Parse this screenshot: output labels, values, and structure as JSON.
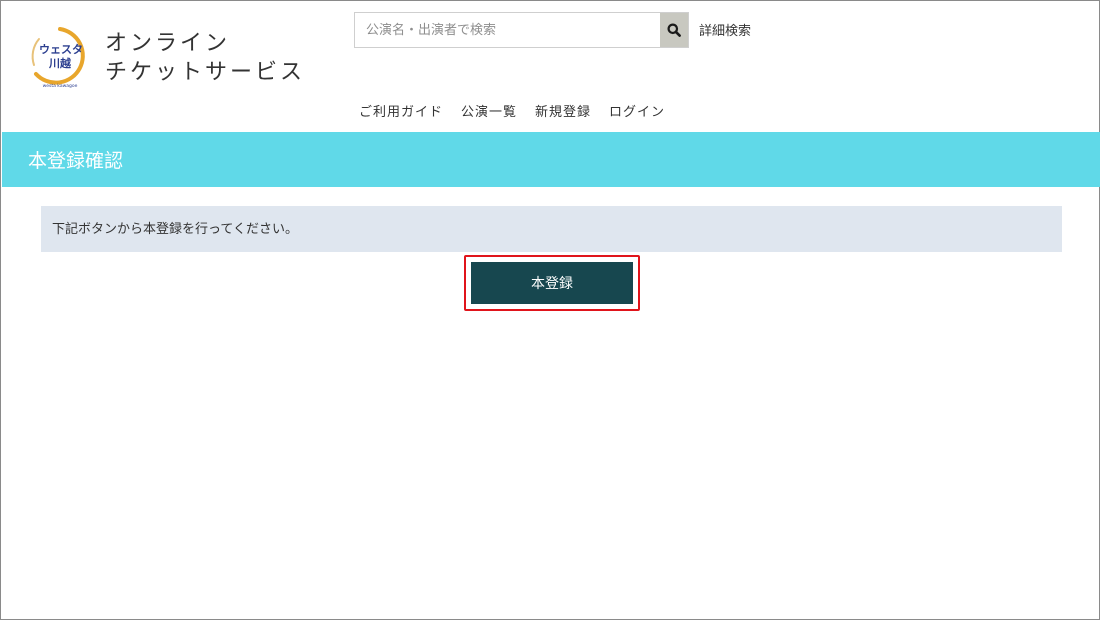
{
  "header": {
    "logo": {
      "lines": [
        "ウェスタ",
        "川越"
      ],
      "subtext": "westa kawagoe"
    },
    "site_title_line1": "オンライン",
    "site_title_line2": "チケットサービス",
    "search": {
      "placeholder": "公演名・出演者で検索",
      "value": "",
      "button_icon": "search-icon"
    },
    "advanced_search_label": "詳細検索",
    "nav": [
      "ご利用ガイド",
      "公演一覧",
      "新規登録",
      "ログイン"
    ]
  },
  "page": {
    "title": "本登録確認",
    "message": "下記ボタンから本登録を行ってください。",
    "register_button_label": "本登録"
  },
  "colors": {
    "title_band": "#60d9e8",
    "message_bg": "#dfe6ef",
    "button_bg": "#17474f",
    "highlight_border": "#e0141b",
    "logo_ring": "#e8a62c",
    "logo_text": "#2b3e8f"
  }
}
